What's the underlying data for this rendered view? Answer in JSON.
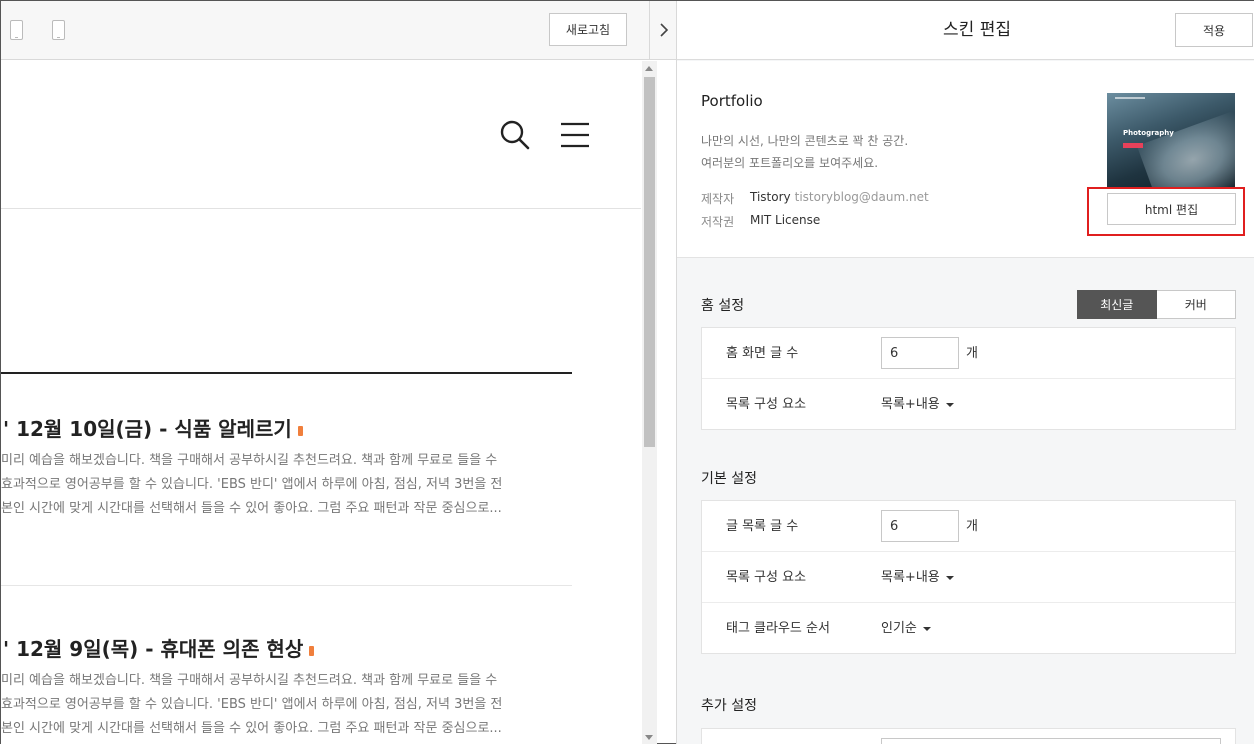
{
  "preview": {
    "refresh_label": "새로고침",
    "posts": [
      {
        "title": "' 12월 10일(금) - 식품 알레르기",
        "excerpt": [
          "미리 예습을 해보겠습니다. 책을 구매해서 공부하시길 추천드려요. 책과 함께 무료로 들을 수",
          " 효과적으로 영어공부를 할 수 있습니다. 'EBS 반디' 앱에서 하루에 아침, 점심, 저녁 3번을 전",
          "본인 시간에 맞게 시간대를 선택해서 들을 수 있어 좋아요. 그럼 주요 패턴과 작문 중심으로..."
        ]
      },
      {
        "title": "' 12월 9일(목) - 휴대폰 의존 현상",
        "excerpt": [
          "미리 예습을 해보겠습니다. 책을 구매해서 공부하시길 추천드려요. 책과 함께 무료로 들을 수",
          " 효과적으로 영어공부를 할 수 있습니다. 'EBS 반디' 앱에서 하루에 아침, 점심, 저녁 3번을 전",
          "본인 시간에 맞게 시간대를 선택해서 들을 수 있어 좋아요. 그럼 주요 패턴과 작문 중심으로..."
        ]
      }
    ]
  },
  "editor": {
    "title": "스킨 편집",
    "apply_label": "적용",
    "skin": {
      "name": "Portfolio",
      "desc_line1": "나만의 시선, 나만의 콘텐츠로 꽉 찬 공간.",
      "desc_line2": "여러분의 포트폴리오를 보여주세요.",
      "author_label": "제작자",
      "author_name": "Tistory",
      "author_email": "tistoryblog@daum.net",
      "license_label": "저작권",
      "license_value": "MIT License",
      "thumb_caption": "Photography",
      "html_edit_label": "html 편집"
    },
    "home_settings": {
      "title": "홈 설정",
      "toggle_latest": "최신글",
      "toggle_cover": "커버",
      "post_count_label": "홈 화면 글 수",
      "post_count_value": "6",
      "unit": "개",
      "list_elements_label": "목록 구성 요소",
      "list_elements_value": "목록+내용"
    },
    "basic_settings": {
      "title": "기본 설정",
      "post_list_count_label": "글 목록 글 수",
      "post_list_count_value": "6",
      "unit": "개",
      "list_elements_label": "목록 구성 요소",
      "list_elements_value": "목록+내용",
      "tag_cloud_label": "태그 클라우드 순서",
      "tag_cloud_value": "인기순"
    },
    "extra_settings": {
      "title": "추가 설정"
    }
  },
  "colors": {
    "highlight": "#e01f1f",
    "toggle_active": "#555555",
    "new_badge": "#f07f3c"
  }
}
